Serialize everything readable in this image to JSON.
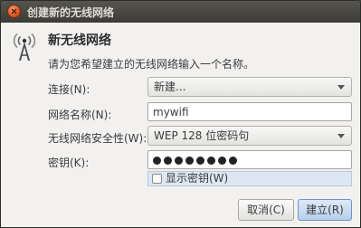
{
  "window": {
    "title": "创建新的无线网络"
  },
  "header": {
    "heading": "新无线网络",
    "description": "请为您希望建立的无线网络输入一个名称。"
  },
  "form": {
    "connection_label": "连接(N):",
    "connection_value": "新建...",
    "network_name_label": "网络名称(N):",
    "network_name_value": "mywifi",
    "security_label": "无线网络安全性(W):",
    "security_value": "WEP 128 位密码句",
    "key_label": "密钥(K):",
    "key_mask_count": 8,
    "show_key_label": "显示密钥(W)",
    "show_key_checked": false
  },
  "buttons": {
    "cancel": "取消(C)",
    "create": "建立(R)"
  },
  "icons": {
    "close": "close-icon",
    "app": "wireless-antenna-icon",
    "dropdown": "chevron-down-icon"
  },
  "colors": {
    "titlebar": "#3c3b37",
    "close": "#e0521f",
    "primary_button": "#b8d0ec"
  }
}
